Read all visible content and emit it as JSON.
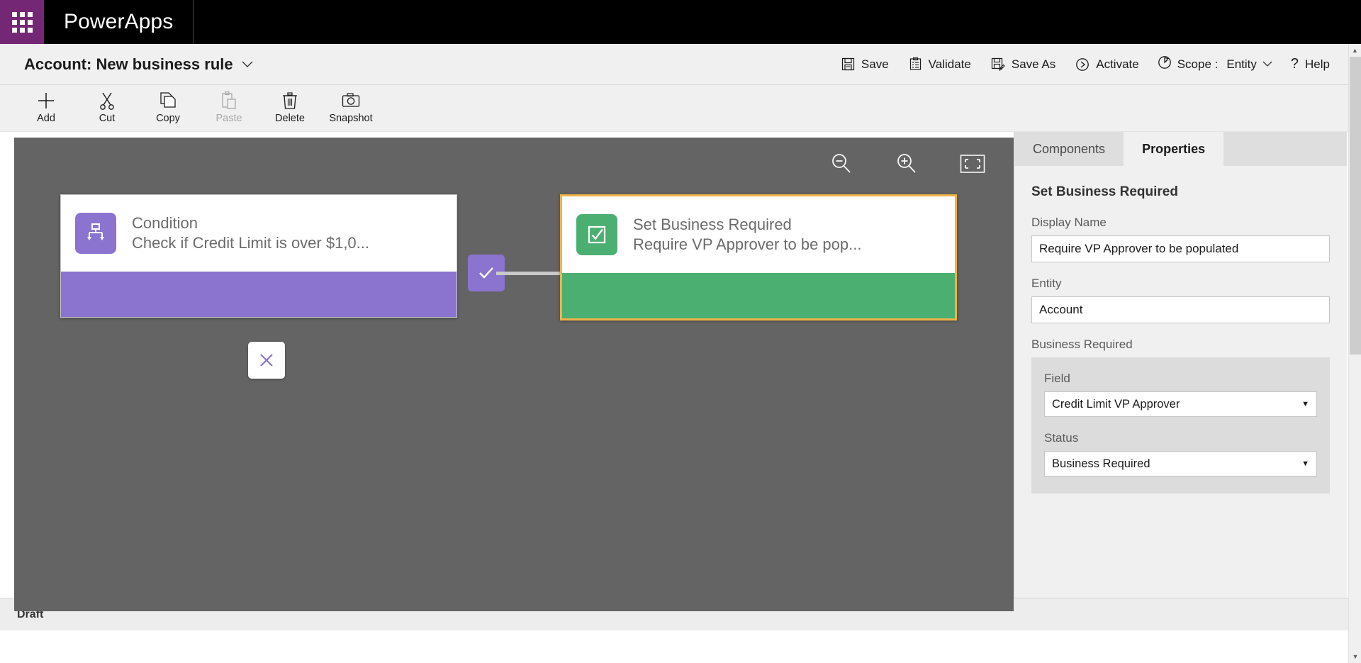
{
  "appbar": {
    "waffle_title": "app-launcher",
    "brand": "PowerApps"
  },
  "commandbar": {
    "title": "Account: New business rule",
    "title_chevron": "⌄",
    "actions": [
      {
        "id": "save",
        "label": "Save",
        "icon": "save-icon"
      },
      {
        "id": "validate",
        "label": "Validate",
        "icon": "validate-icon"
      },
      {
        "id": "save-as",
        "label": "Save As",
        "icon": "save-as-icon"
      },
      {
        "id": "activate",
        "label": "Activate",
        "icon": "activate-icon"
      }
    ],
    "scope_label": "Scope :",
    "scope_value": "Entity",
    "scope_chevron": "⌄",
    "help_label": "Help",
    "help_glyph": "?"
  },
  "toolbar": {
    "items": [
      {
        "id": "add",
        "label": "Add",
        "icon": "plus-icon",
        "disabled": false
      },
      {
        "id": "cut",
        "label": "Cut",
        "icon": "scissors-icon",
        "disabled": false
      },
      {
        "id": "copy",
        "label": "Copy",
        "icon": "copy-icon",
        "disabled": false
      },
      {
        "id": "paste",
        "label": "Paste",
        "icon": "clipboard-icon",
        "disabled": true
      },
      {
        "id": "delete",
        "label": "Delete",
        "icon": "trash-icon",
        "disabled": false
      },
      {
        "id": "snapshot",
        "label": "Snapshot",
        "icon": "camera-icon",
        "disabled": false
      }
    ]
  },
  "canvas": {
    "background_color": "#646464",
    "tools": [
      {
        "id": "zoom-out",
        "icon": "zoom-out-icon"
      },
      {
        "id": "zoom-in",
        "icon": "zoom-in-icon"
      },
      {
        "id": "fit-to-screen",
        "icon": "fit-screen-icon"
      }
    ],
    "nodes": [
      {
        "id": "condition",
        "title": "Condition",
        "subtitle": "Check if Credit Limit is over $1,0...",
        "accent_color": "#8a74d0",
        "icon": "condition-branch-icon",
        "selected": false
      },
      {
        "id": "set-business-required",
        "title": "Set Business Required",
        "subtitle": "Require VP Approver to be pop...",
        "accent_color": "#4caf72",
        "icon": "checkbox-checked-icon",
        "selected": true,
        "selection_color": "#efb447"
      }
    ],
    "branches": [
      {
        "id": "yes-branch",
        "icon": "check-icon",
        "color": "#8a74d0"
      },
      {
        "id": "no-branch",
        "icon": "cross-icon",
        "color": "#ffffff"
      }
    ]
  },
  "panel": {
    "tabs": [
      {
        "id": "components",
        "label": "Components",
        "active": false
      },
      {
        "id": "properties",
        "label": "Properties",
        "active": true
      }
    ],
    "heading": "Set Business Required",
    "fields": [
      {
        "id": "display-name",
        "label": "Display Name",
        "value": "Require VP Approver to be populated"
      },
      {
        "id": "entity",
        "label": "Entity",
        "value": "Account"
      }
    ],
    "group": {
      "label": "Business Required",
      "selects": [
        {
          "id": "field",
          "label": "Field",
          "value": "Credit Limit VP Approver",
          "caret": "▼"
        },
        {
          "id": "status",
          "label": "Status",
          "value": "Business Required",
          "caret": "▼"
        }
      ]
    }
  },
  "statusbar": {
    "state": "Draft"
  },
  "scrollbar": {
    "up_arrow": "▲",
    "down_arrow": "▼"
  }
}
